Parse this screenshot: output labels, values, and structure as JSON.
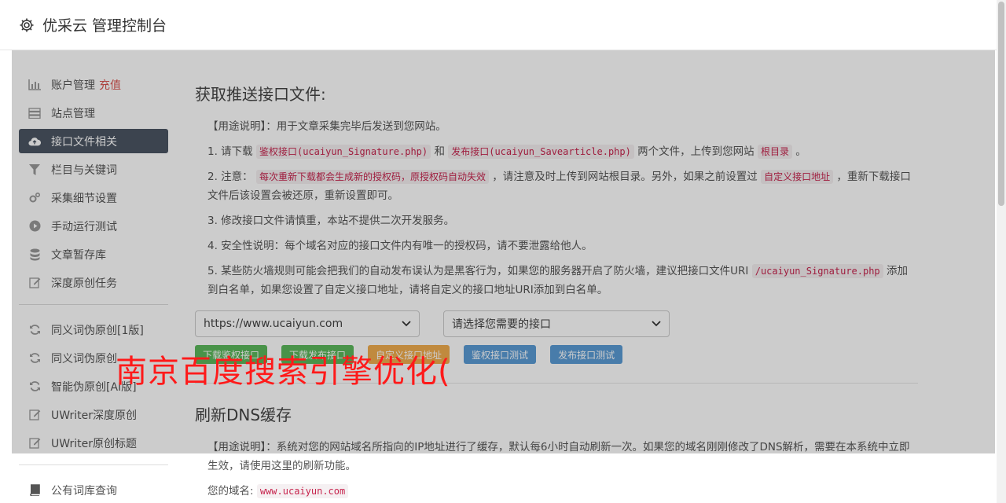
{
  "app": {
    "title": "优采云 管理控制台"
  },
  "sidebar": {
    "group1": [
      {
        "label": "账户管理",
        "extra": "充值",
        "icon": "bar-chart-icon"
      },
      {
        "label": "站点管理",
        "icon": "server-icon"
      },
      {
        "label": "接口文件相关",
        "icon": "cloud-upload-icon",
        "active": true
      },
      {
        "label": "栏目与关键词",
        "icon": "filter-icon"
      },
      {
        "label": "采集细节设置",
        "icon": "gears-icon"
      },
      {
        "label": "手动运行测试",
        "icon": "play-circle-icon"
      },
      {
        "label": "文章暂存库",
        "icon": "database-icon"
      },
      {
        "label": "深度原创任务",
        "icon": "edit-icon"
      }
    ],
    "group2": [
      {
        "label": "同义词伪原创[1版]",
        "icon": "refresh-icon"
      },
      {
        "label": "同义词伪原创",
        "icon": "refresh-icon"
      },
      {
        "label": "智能伪原创[AI版]",
        "icon": "refresh-icon"
      },
      {
        "label": "UWriter深度原创",
        "icon": "edit-icon"
      },
      {
        "label": "UWriter原创标题",
        "icon": "edit-icon"
      }
    ],
    "group3": [
      {
        "label": "公有词库查询",
        "icon": "book-icon"
      }
    ]
  },
  "section1": {
    "title": "获取推送接口文件:",
    "usage": "【用途说明】：用于文章采集完毕后发送到您网站。",
    "item1": {
      "a": "1. 请下载",
      "code1": "鉴权接口(ucaiyun_Signature.php)",
      "b": "和",
      "code2": "发布接口(ucaiyun_Savearticle.php)",
      "c": "两个文件，上传到您网站",
      "code3": "根目录",
      "d": "。"
    },
    "item2": {
      "a": "2. 注意：",
      "code1": "每次重新下载都会生成新的授权码，原授权码自动失效",
      "b": "，请注意及时上传到网站根目录。另外，如果之前设置过",
      "code2": "自定义接口地址",
      "c": "，重新下载接口文件后该设置会被还原，重新设置即可。"
    },
    "item3": "3. 修改接口文件请慎重，本站不提供二次开发服务。",
    "item4": "4. 安全性说明：每个域名对应的接口文件内有唯一的授权码，请不要泄露给他人。",
    "item5": {
      "a": "5. 某些防火墙规则可能会把我们的自动发布误认为是黑客行为，如果您的服务器开启了防火墙，建议把接口文件URI",
      "code1": "/ucaiyun_Signature.php",
      "b": "添加到白名单，如果您设置了自定义接口地址，请将自定义的接口地址URI添加到白名单。"
    },
    "site_select": "https://www.ucaiyun.com",
    "api_select": "请选择您需要的接口",
    "buttons": {
      "download_auth": "下载鉴权接口",
      "download_publish": "下载发布接口",
      "custom_addr": "自定义接口地址",
      "test_auth": "鉴权接口测试",
      "test_publish": "发布接口测试"
    }
  },
  "section2": {
    "title": "刷新DNS缓存",
    "usage": "【用途说明】：系统对您的网站域名所指向的IP地址进行了缓存，默认每6小时自动刷新一次。如果您的域名刚刚修改了DNS解析，需要在本系统中立即生效，请使用这里的刷新功能。",
    "domain_label": "您的域名:",
    "domain_value": "www.ucaiyun.com"
  },
  "watermark": "南京百度搜索引擎优化(",
  "colors": {
    "active_bg": "#4b5563",
    "green": "#5cb85c",
    "orange": "#f0ad4e",
    "blue": "#5b9bd5",
    "recharge": "#d9534f",
    "watermark": "#ff1a1a"
  }
}
